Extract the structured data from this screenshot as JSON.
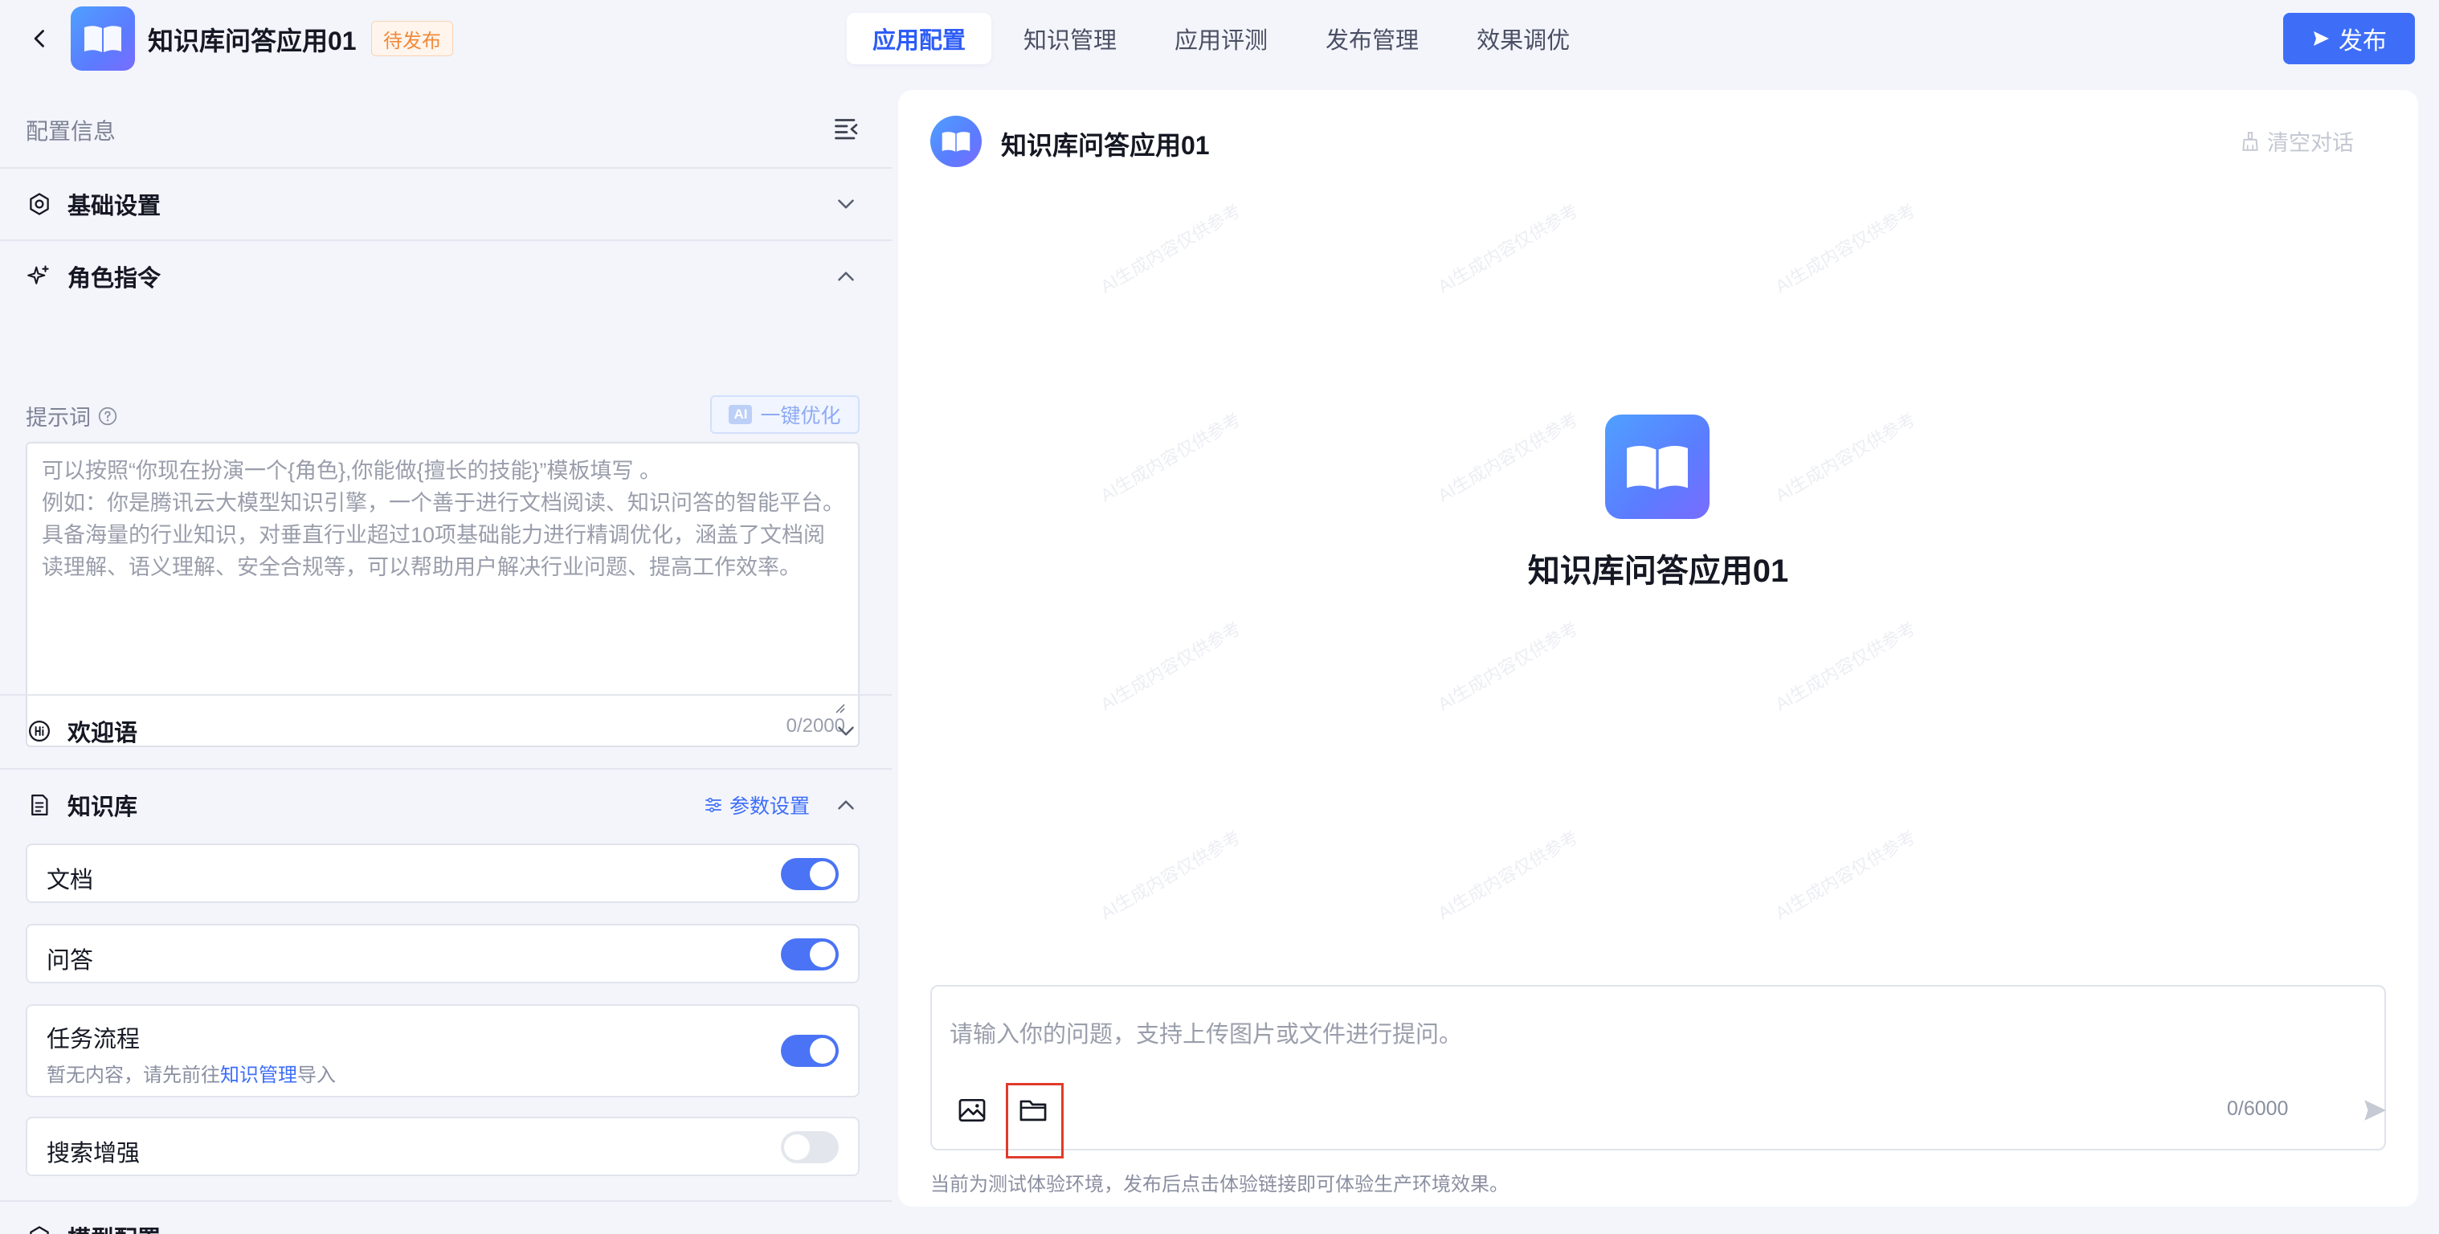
{
  "header": {
    "app_name": "知识库问答应用01",
    "status": "待发布",
    "tabs": [
      {
        "label": "应用配置",
        "active": true
      },
      {
        "label": "知识管理",
        "active": false
      },
      {
        "label": "应用评测",
        "active": false
      },
      {
        "label": "发布管理",
        "active": false
      },
      {
        "label": "效果调优",
        "active": false
      }
    ],
    "publish_label": "发布",
    "accent_color": "#3e6ef8"
  },
  "left": {
    "panel_title": "配置信息",
    "sections": {
      "basic": "基础设置",
      "role": "角色指令",
      "welcome": "欢迎语",
      "knowledge": "知识库",
      "model": "模型配置"
    },
    "prompt": {
      "label": "提示词",
      "ai_chip": "AI",
      "optimize_label": "一键优化",
      "placeholder": "可以按照“你现在扮演一个{角色},你能做{擅长的技能}”模板填写 。\n例如：你是腾讯云大模型知识引擎，一个善于进行文档阅读、知识问答的智能平台。具备海量的行业知识，对垂直行业超过10项基础能力进行精调优化，涵盖了文档阅读理解、语义理解、安全合规等，可以帮助用户解决行业问题、提高工作效率。",
      "count": "0/2000"
    },
    "knowledge": {
      "param_label": "参数设置",
      "items": [
        {
          "title": "文档",
          "enabled": true
        },
        {
          "title": "问答",
          "enabled": true
        },
        {
          "title": "任务流程",
          "enabled": true,
          "sub_prefix": "暂无内容，请先前往",
          "sub_link": "知识管理",
          "sub_suffix": "导入"
        },
        {
          "title": "搜索增强",
          "enabled": false
        }
      ]
    }
  },
  "chat": {
    "title": "知识库问答应用01",
    "clear_label": "清空对话",
    "center_title": "知识库问答应用01",
    "input_placeholder": "请输入你的问题，支持上传图片或文件进行提问。",
    "input_count": "0/6000",
    "footer_note": "当前为测试体验环境，发布后点击体验链接即可体验生产环境效果。",
    "watermark": "AI生成内容仅供参考"
  }
}
